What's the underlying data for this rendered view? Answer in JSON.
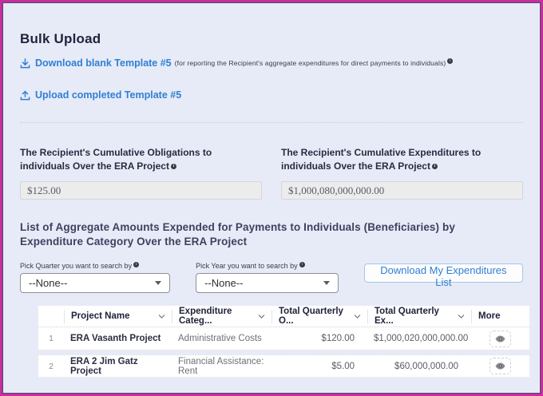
{
  "title": "Bulk Upload",
  "links": {
    "download_label": "Download blank Template #5",
    "download_note": "(for reporting the Recipient's aggregate expenditures for direct payments to individuals)",
    "upload_label": "Upload completed Template #5"
  },
  "summary_fields": {
    "obligations_label": "The Recipient's Cumulative Obligations to individuals Over the ERA Project",
    "obligations_value": "$125.00",
    "expenditures_label": "The Recipient's Cumulative Expenditures to individuals Over the ERA Project",
    "expenditures_value": "$1,000,080,000,000.00"
  },
  "list_section": {
    "heading": "List of Aggregate Amounts Expended for Payments to Individuals (Beneficiaries) by Expenditure Category Over the ERA Project",
    "quarter_label": "Pick Quarter you want to search by",
    "quarter_value": "--None--",
    "year_label": "Pick Year you want to search by",
    "year_value": "--None--",
    "download_button_label": "Download My Expenditures List"
  },
  "table": {
    "headers": {
      "project": "Project Name",
      "category": "Expenditure Categ...",
      "total_obligations": "Total Quarterly O...",
      "total_expenditures": "Total Quarterly Ex...",
      "more": "More"
    },
    "rows": [
      {
        "num": "1",
        "project": "ERA Vasanth Project",
        "category": "Administrative Costs",
        "total_obligations": "$120.00",
        "total_expenditures": "$1,000,020,000,000.00"
      },
      {
        "num": "2",
        "project": "ERA 2 Jim Gatz Project",
        "category": "Financial Assistance: Rent",
        "total_obligations": "$5.00",
        "total_expenditures": "$60,000,000.00"
      }
    ]
  },
  "colors": {
    "accent_blue": "#2f7fd3",
    "border_magenta": "#c4309f",
    "page_background": "#e7ebf8"
  }
}
